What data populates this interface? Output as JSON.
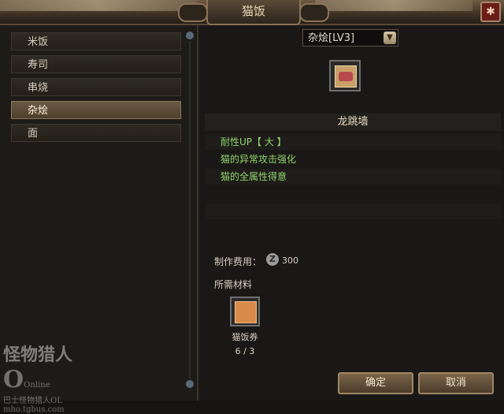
{
  "window": {
    "title": "猫饭",
    "close_glyph": "✱"
  },
  "categories": [
    {
      "label": "米饭"
    },
    {
      "label": "寿司"
    },
    {
      "label": "串烧"
    },
    {
      "label": "杂烩",
      "selected": true
    },
    {
      "label": "面"
    }
  ],
  "level_select": {
    "value": "杂烩[LV3]"
  },
  "dish": {
    "icon": "cat-meal-icon",
    "name": "龙跳墙",
    "effects": [
      "耐性UP【 大 】",
      "猫的异常攻击强化",
      "猫的全属性得意"
    ]
  },
  "cost": {
    "label": "制作费用：",
    "currency_icon": "zenny-icon",
    "currency_glyph": "Z",
    "value": "300"
  },
  "materials": {
    "label": "所需材料",
    "items": [
      {
        "icon": "meal-ticket-icon",
        "name": "猫饭券",
        "count": "6 / 3"
      }
    ]
  },
  "buttons": {
    "confirm": "确定",
    "cancel": "取消"
  },
  "watermark": {
    "logo_text": "怪物猎人",
    "logo_o": "O",
    "online": "Online",
    "line1": "巴士怪物猎人OL",
    "line2": "mho.tgbus.com"
  },
  "colors": {
    "effect_text": "#8fd46a",
    "selected_item": "#6b5a42",
    "close_button": "#6a1e16"
  }
}
